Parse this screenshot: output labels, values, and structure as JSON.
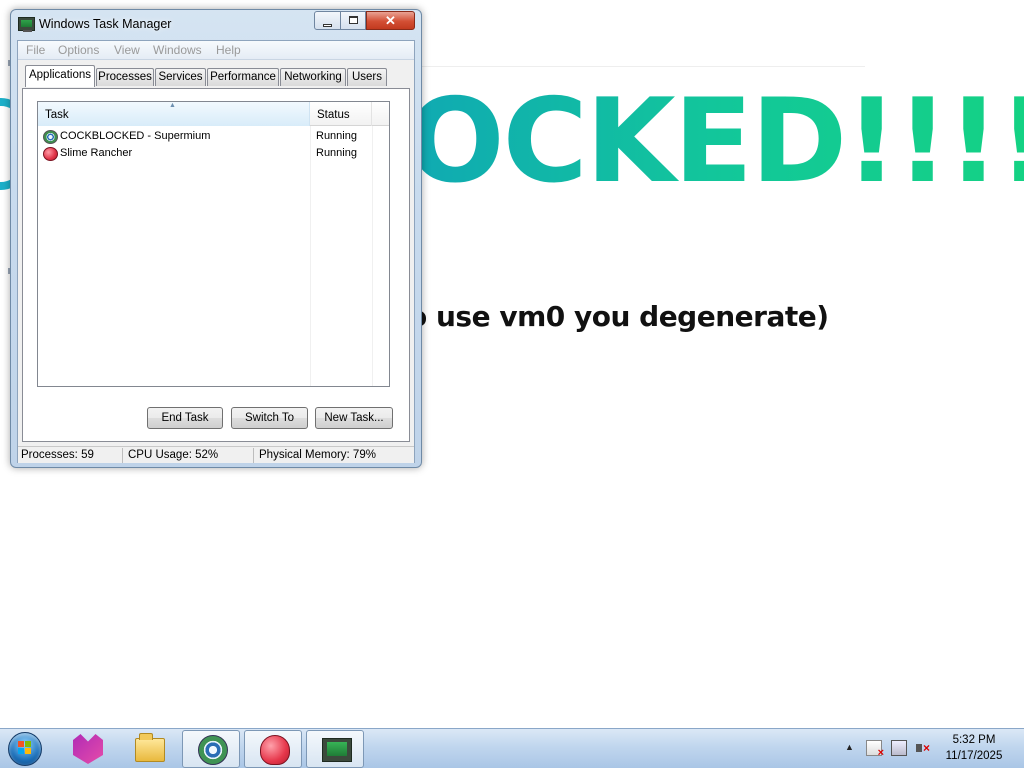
{
  "background": {
    "headline": "OCKED!!!!!!!",
    "subline": "o use vm0 you degenerate)"
  },
  "window": {
    "title": "Windows Task Manager",
    "icon": "task-manager-icon",
    "close_glyph": "✕"
  },
  "menu": {
    "items": [
      "File",
      "Options",
      "View",
      "Windows",
      "Help"
    ]
  },
  "tabs": [
    "Applications",
    "Processes",
    "Services",
    "Performance",
    "Networking",
    "Users"
  ],
  "active_tab": "Applications",
  "list": {
    "columns": {
      "task": "Task",
      "status": "Status"
    },
    "rows": [
      {
        "task": "COCKBLOCKED - Supermium",
        "status": "Running",
        "icon": "supermium-icon"
      },
      {
        "task": "Slime Rancher",
        "status": "Running",
        "icon": "slime-icon"
      }
    ]
  },
  "buttons": {
    "end_task": "End Task",
    "switch_to": "Switch To",
    "new_task": "New Task..."
  },
  "status_bar": {
    "processes": "Processes: 59",
    "cpu": "CPU Usage: 52%",
    "memory": "Physical Memory: 79%"
  },
  "taskbar": {
    "pinned": [
      "fox-icon",
      "folder-icon",
      "supermium-icon",
      "slime-icon",
      "task-manager-icon"
    ],
    "clock_time": "5:32 PM",
    "clock_date": "11/17/2025"
  },
  "colors": {
    "headline_start": "#10a9b3",
    "headline_end": "#16d877",
    "close_button": "#d34f34",
    "taskbar": "#c0d6ee"
  }
}
